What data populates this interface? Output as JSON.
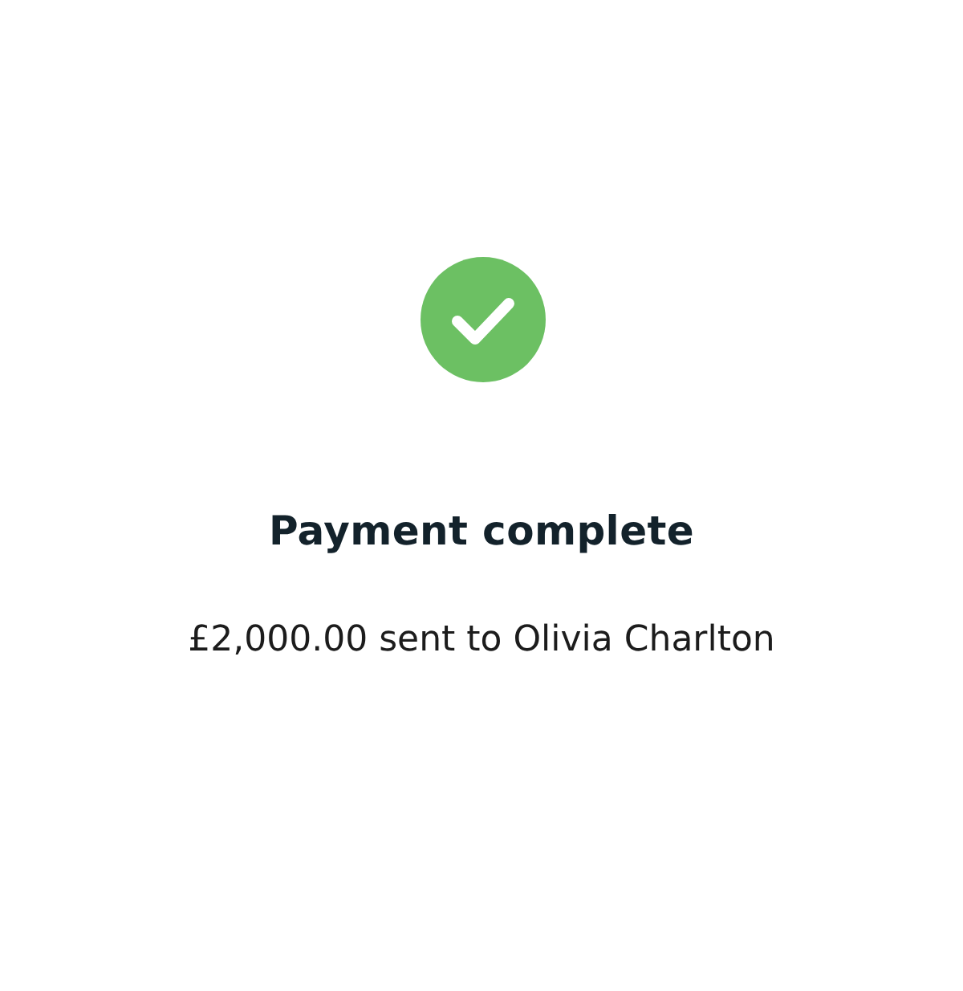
{
  "status": {
    "kind": "success"
  },
  "title": "Payment complete",
  "message": "£2,000.00 sent to Olivia Charlton"
}
